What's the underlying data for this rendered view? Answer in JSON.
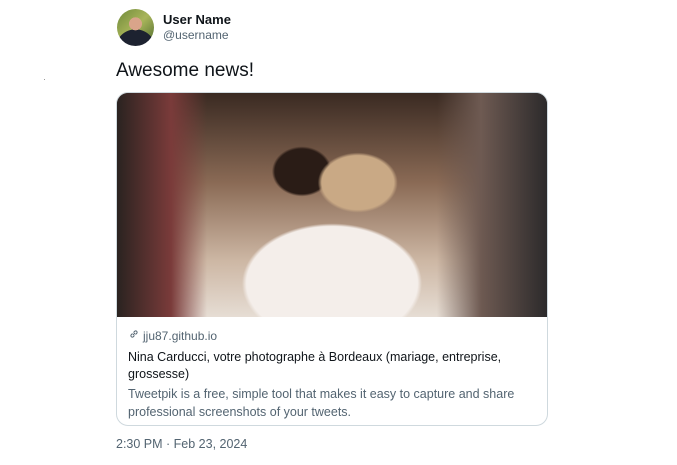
{
  "user": {
    "name": "User Name",
    "handle": "@username"
  },
  "tweet": {
    "text": "Awesome news!",
    "timestamp": "2:30 PM · Feb 23, 2024"
  },
  "card": {
    "domain": "jju87.github.io",
    "title": "Nina Carducci, votre photographe à Bordeaux (mariage, entreprise, grossesse)",
    "description": "Tweetpik is a free, simple tool that makes it easy to capture and share professional screenshots of your tweets.",
    "icon": "link-icon"
  }
}
